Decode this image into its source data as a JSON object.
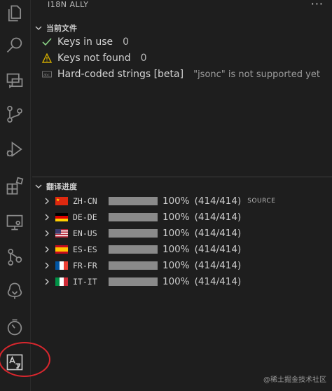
{
  "panel": {
    "title": "I18N ALLY",
    "more_label": "···"
  },
  "current_file": {
    "title": "当前文件",
    "items": [
      {
        "label": "Keys in use",
        "count": "0",
        "icon": "check-icon",
        "color": "#89d185"
      },
      {
        "label": "Keys not found",
        "count": "0",
        "icon": "warning-icon",
        "color": "#cca700"
      },
      {
        "label": "Hard-coded strings [beta]",
        "desc": "\"jsonc\" is not supported yet",
        "icon": "string-icon"
      }
    ]
  },
  "progress": {
    "title": "翻译进度",
    "languages": [
      {
        "code": "ZH-CN",
        "flag": "cn",
        "percent": "100%",
        "count": "(414/414)",
        "tag": "SOURCE",
        "fill": 1.0
      },
      {
        "code": "DE-DE",
        "flag": "de",
        "percent": "100%",
        "count": "(414/414)",
        "fill": 1.0
      },
      {
        "code": "EN-US",
        "flag": "us",
        "percent": "100%",
        "count": "(414/414)",
        "fill": 1.0
      },
      {
        "code": "ES-ES",
        "flag": "es",
        "percent": "100%",
        "count": "(414/414)",
        "fill": 1.0
      },
      {
        "code": "FR-FR",
        "flag": "fr",
        "percent": "100%",
        "count": "(414/414)",
        "fill": 1.0
      },
      {
        "code": "IT-IT",
        "flag": "it",
        "percent": "100%",
        "count": "(414/414)",
        "fill": 1.0
      }
    ]
  },
  "activity_bar": [
    "explorer-icon",
    "search-icon",
    "remote-explorer-icon",
    "source-control-icon",
    "run-debug-icon",
    "extensions-icon",
    "remote-window-icon",
    "git-graph-icon",
    "tree-icon",
    "timeline-icon",
    "i18n-ally-icon"
  ],
  "watermark": "@稀土掘金技术社区",
  "colors": {
    "highlight": "#d9272e",
    "bar": "#8a8a8a"
  }
}
